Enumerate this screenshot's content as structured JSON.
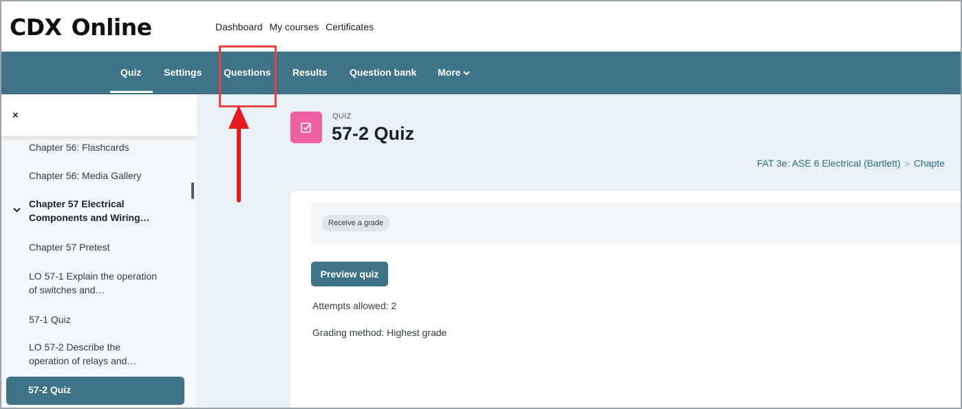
{
  "logo": {
    "part1": "CDX",
    "part2": "Online"
  },
  "topnav": [
    "Dashboard",
    "My courses",
    "Certificates"
  ],
  "secondary_nav": {
    "items": [
      "Quiz",
      "Settings",
      "Questions",
      "Results",
      "Question bank",
      "More"
    ],
    "active": "Quiz"
  },
  "drawer": {
    "close": "×",
    "items": [
      "Chapter 56: Flashcards",
      "Chapter 56: Media Gallery",
      "Chapter 57 Electrical Components and Wiring…",
      "Chapter 57 Pretest",
      "LO 57-1 Explain the operation of switches and…",
      "57-1 Quiz",
      "LO 57-2 Describe the operation of relays and…",
      "57-2 Quiz"
    ],
    "active": "57-2 Quiz"
  },
  "activity": {
    "type_label": "QUIZ",
    "title": "57-2 Quiz",
    "icon": "checkbox-icon",
    "icon_color": "#ec5fa0"
  },
  "breadcrumb": [
    "FAT 3e: ASE 6 Electrical (Bartlett)",
    "Chapte"
  ],
  "completion": {
    "badge": "Receive a grade"
  },
  "preview_button": "Preview quiz",
  "info": {
    "attempts": "Attempts allowed: 2",
    "grading": "Grading method: Highest grade"
  },
  "colors": {
    "brand_teal": "#3f7387",
    "logo_red": "#c8102e",
    "annotation_red": "#e6191f"
  }
}
